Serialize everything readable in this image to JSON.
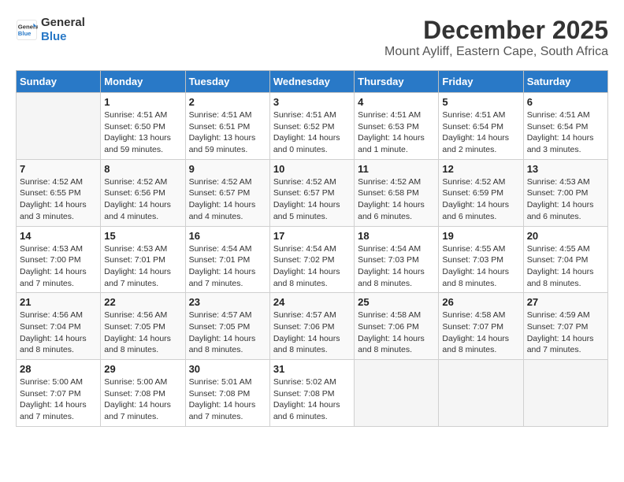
{
  "logo": {
    "line1": "General",
    "line2": "Blue"
  },
  "header": {
    "month": "December 2025",
    "location": "Mount Ayliff, Eastern Cape, South Africa"
  },
  "days_of_week": [
    "Sunday",
    "Monday",
    "Tuesday",
    "Wednesday",
    "Thursday",
    "Friday",
    "Saturday"
  ],
  "weeks": [
    [
      {
        "num": "",
        "info": ""
      },
      {
        "num": "1",
        "info": "Sunrise: 4:51 AM\nSunset: 6:50 PM\nDaylight: 13 hours\nand 59 minutes."
      },
      {
        "num": "2",
        "info": "Sunrise: 4:51 AM\nSunset: 6:51 PM\nDaylight: 13 hours\nand 59 minutes."
      },
      {
        "num": "3",
        "info": "Sunrise: 4:51 AM\nSunset: 6:52 PM\nDaylight: 14 hours\nand 0 minutes."
      },
      {
        "num": "4",
        "info": "Sunrise: 4:51 AM\nSunset: 6:53 PM\nDaylight: 14 hours\nand 1 minute."
      },
      {
        "num": "5",
        "info": "Sunrise: 4:51 AM\nSunset: 6:54 PM\nDaylight: 14 hours\nand 2 minutes."
      },
      {
        "num": "6",
        "info": "Sunrise: 4:51 AM\nSunset: 6:54 PM\nDaylight: 14 hours\nand 3 minutes."
      }
    ],
    [
      {
        "num": "7",
        "info": "Sunrise: 4:52 AM\nSunset: 6:55 PM\nDaylight: 14 hours\nand 3 minutes."
      },
      {
        "num": "8",
        "info": "Sunrise: 4:52 AM\nSunset: 6:56 PM\nDaylight: 14 hours\nand 4 minutes."
      },
      {
        "num": "9",
        "info": "Sunrise: 4:52 AM\nSunset: 6:57 PM\nDaylight: 14 hours\nand 4 minutes."
      },
      {
        "num": "10",
        "info": "Sunrise: 4:52 AM\nSunset: 6:57 PM\nDaylight: 14 hours\nand 5 minutes."
      },
      {
        "num": "11",
        "info": "Sunrise: 4:52 AM\nSunset: 6:58 PM\nDaylight: 14 hours\nand 6 minutes."
      },
      {
        "num": "12",
        "info": "Sunrise: 4:52 AM\nSunset: 6:59 PM\nDaylight: 14 hours\nand 6 minutes."
      },
      {
        "num": "13",
        "info": "Sunrise: 4:53 AM\nSunset: 7:00 PM\nDaylight: 14 hours\nand 6 minutes."
      }
    ],
    [
      {
        "num": "14",
        "info": "Sunrise: 4:53 AM\nSunset: 7:00 PM\nDaylight: 14 hours\nand 7 minutes."
      },
      {
        "num": "15",
        "info": "Sunrise: 4:53 AM\nSunset: 7:01 PM\nDaylight: 14 hours\nand 7 minutes."
      },
      {
        "num": "16",
        "info": "Sunrise: 4:54 AM\nSunset: 7:01 PM\nDaylight: 14 hours\nand 7 minutes."
      },
      {
        "num": "17",
        "info": "Sunrise: 4:54 AM\nSunset: 7:02 PM\nDaylight: 14 hours\nand 8 minutes."
      },
      {
        "num": "18",
        "info": "Sunrise: 4:54 AM\nSunset: 7:03 PM\nDaylight: 14 hours\nand 8 minutes."
      },
      {
        "num": "19",
        "info": "Sunrise: 4:55 AM\nSunset: 7:03 PM\nDaylight: 14 hours\nand 8 minutes."
      },
      {
        "num": "20",
        "info": "Sunrise: 4:55 AM\nSunset: 7:04 PM\nDaylight: 14 hours\nand 8 minutes."
      }
    ],
    [
      {
        "num": "21",
        "info": "Sunrise: 4:56 AM\nSunset: 7:04 PM\nDaylight: 14 hours\nand 8 minutes."
      },
      {
        "num": "22",
        "info": "Sunrise: 4:56 AM\nSunset: 7:05 PM\nDaylight: 14 hours\nand 8 minutes."
      },
      {
        "num": "23",
        "info": "Sunrise: 4:57 AM\nSunset: 7:05 PM\nDaylight: 14 hours\nand 8 minutes."
      },
      {
        "num": "24",
        "info": "Sunrise: 4:57 AM\nSunset: 7:06 PM\nDaylight: 14 hours\nand 8 minutes."
      },
      {
        "num": "25",
        "info": "Sunrise: 4:58 AM\nSunset: 7:06 PM\nDaylight: 14 hours\nand 8 minutes."
      },
      {
        "num": "26",
        "info": "Sunrise: 4:58 AM\nSunset: 7:07 PM\nDaylight: 14 hours\nand 8 minutes."
      },
      {
        "num": "27",
        "info": "Sunrise: 4:59 AM\nSunset: 7:07 PM\nDaylight: 14 hours\nand 7 minutes."
      }
    ],
    [
      {
        "num": "28",
        "info": "Sunrise: 5:00 AM\nSunset: 7:07 PM\nDaylight: 14 hours\nand 7 minutes."
      },
      {
        "num": "29",
        "info": "Sunrise: 5:00 AM\nSunset: 7:08 PM\nDaylight: 14 hours\nand 7 minutes."
      },
      {
        "num": "30",
        "info": "Sunrise: 5:01 AM\nSunset: 7:08 PM\nDaylight: 14 hours\nand 7 minutes."
      },
      {
        "num": "31",
        "info": "Sunrise: 5:02 AM\nSunset: 7:08 PM\nDaylight: 14 hours\nand 6 minutes."
      },
      {
        "num": "",
        "info": ""
      },
      {
        "num": "",
        "info": ""
      },
      {
        "num": "",
        "info": ""
      }
    ]
  ]
}
